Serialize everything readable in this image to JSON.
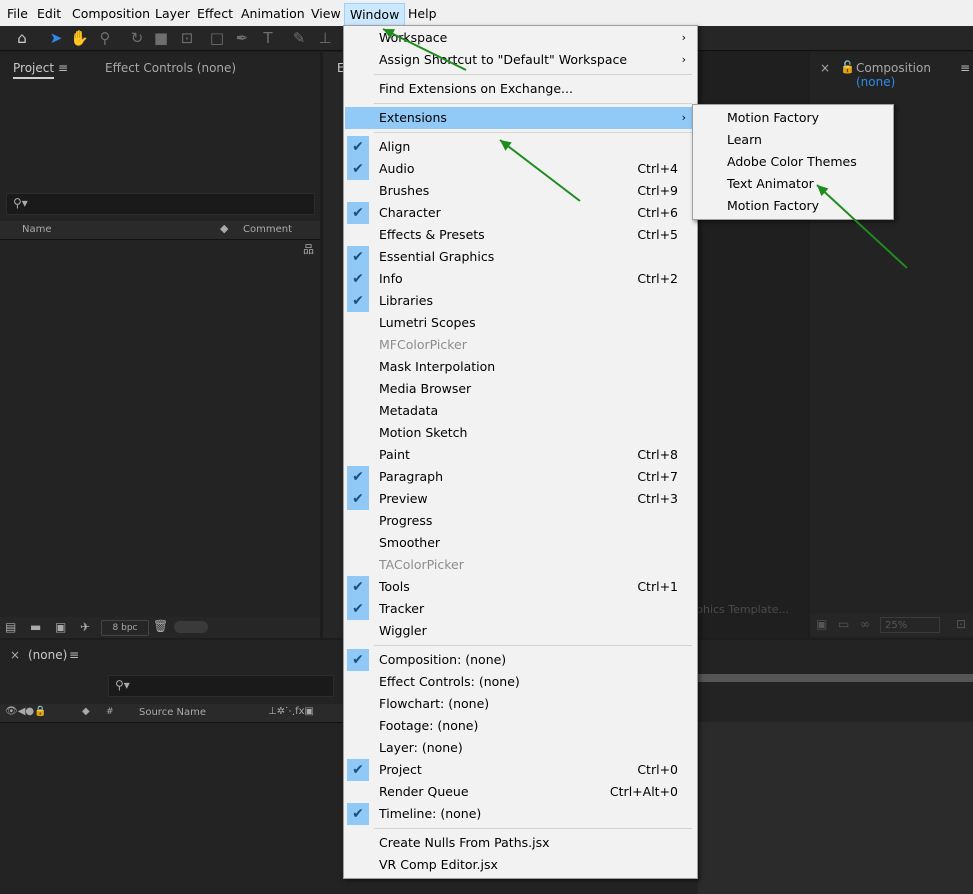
{
  "menubar": [
    "File",
    "Edit",
    "Composition",
    "Layer",
    "Effect",
    "Animation",
    "View",
    "Window",
    "Help"
  ],
  "project_panel": {
    "tab": "Project",
    "tab2": "Effect Controls (none)",
    "col_name": "Name",
    "col_comment": "Comment",
    "bpc": "8 bpc"
  },
  "comp_panel": {
    "tab": "Composition",
    "tab_value": "(none)",
    "zoom": "25%",
    "graphics_template": "phics Template..."
  },
  "timeline": {
    "tab": "(none)",
    "source_name": "Source Name"
  },
  "window_menu": {
    "items": [
      {
        "label": "Workspace",
        "submenu": true
      },
      {
        "label": "Assign Shortcut to \"Default\" Workspace",
        "submenu": true
      },
      {
        "sep": true
      },
      {
        "label": "Find Extensions on Exchange..."
      },
      {
        "sep": true
      },
      {
        "label": "Extensions",
        "submenu": true,
        "highlight": true
      },
      {
        "sep": true
      },
      {
        "label": "Align",
        "checked": true
      },
      {
        "label": "Audio",
        "checked": true,
        "shortcut": "Ctrl+4"
      },
      {
        "label": "Brushes",
        "shortcut": "Ctrl+9"
      },
      {
        "label": "Character",
        "checked": true,
        "shortcut": "Ctrl+6"
      },
      {
        "label": "Effects & Presets",
        "shortcut": "Ctrl+5"
      },
      {
        "label": "Essential Graphics",
        "checked": true
      },
      {
        "label": "Info",
        "checked": true,
        "shortcut": "Ctrl+2"
      },
      {
        "label": "Libraries",
        "checked": true
      },
      {
        "label": "Lumetri Scopes"
      },
      {
        "label": "MFColorPicker",
        "disabled": true
      },
      {
        "label": "Mask Interpolation"
      },
      {
        "label": "Media Browser"
      },
      {
        "label": "Metadata"
      },
      {
        "label": "Motion Sketch"
      },
      {
        "label": "Paint",
        "shortcut": "Ctrl+8"
      },
      {
        "label": "Paragraph",
        "checked": true,
        "shortcut": "Ctrl+7"
      },
      {
        "label": "Preview",
        "checked": true,
        "shortcut": "Ctrl+3"
      },
      {
        "label": "Progress"
      },
      {
        "label": "Smoother"
      },
      {
        "label": "TAColorPicker",
        "disabled": true
      },
      {
        "label": "Tools",
        "checked": true,
        "shortcut": "Ctrl+1"
      },
      {
        "label": "Tracker",
        "checked": true
      },
      {
        "label": "Wiggler"
      },
      {
        "sep": true
      },
      {
        "label": "Composition: (none)",
        "checked": true
      },
      {
        "label": "Effect Controls: (none)"
      },
      {
        "label": "Flowchart: (none)"
      },
      {
        "label": "Footage: (none)"
      },
      {
        "label": "Layer: (none)"
      },
      {
        "label": "Project",
        "checked": true,
        "shortcut": "Ctrl+0"
      },
      {
        "label": "Render Queue",
        "shortcut": "Ctrl+Alt+0"
      },
      {
        "label": "Timeline: (none)",
        "checked": true
      },
      {
        "sep": true
      },
      {
        "label": "Create Nulls From Paths.jsx"
      },
      {
        "label": "VR Comp Editor.jsx"
      }
    ]
  },
  "extensions_submenu": [
    "Motion Factory",
    "Learn",
    "Adobe Color Themes",
    "Text Animator",
    "Motion Factory"
  ],
  "colors": {
    "highlight": "#91c9f7",
    "arrow": "#1e8c1e",
    "accent_blue": "#2d8ceb"
  }
}
